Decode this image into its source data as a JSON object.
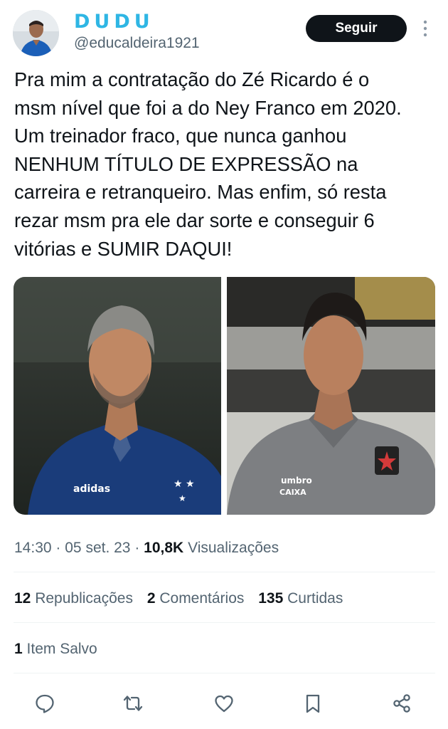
{
  "author": {
    "display_name": "DUDU",
    "handle": "@educaldeira1921"
  },
  "follow_label": "Seguir",
  "tweet": {
    "text": "Pra mim a contratação do Zé Ricardo é o\nmsm nível que foi a do Ney Franco em 2020.\nUm treinador fraco, que nunca ganhou\nNENHUM TÍTULO DE EXPRESSÃO na\ncarreira e retranqueiro. Mas enfim, só resta\nrezar msm pra ele dar sorte e conseguir 6\nvitórias e SUMIR DAQUI!"
  },
  "meta": {
    "time": "14:30",
    "separator": "·",
    "date": "05 set. 23",
    "views_count": "10,8K",
    "views_label": "Visualizações"
  },
  "stats": {
    "reposts_count": "12",
    "reposts_label": "Republicações",
    "comments_count": "2",
    "comments_label": "Comentários",
    "likes_count": "135",
    "likes_label": "Curtidas"
  },
  "saved": {
    "count": "1",
    "label": "Item Salvo"
  },
  "actions": [
    "reply-icon",
    "repost-icon",
    "like-icon",
    "bookmark-icon",
    "share-icon"
  ],
  "colors": {
    "name_accent": "#2fb6e4",
    "text": "#0f1419",
    "secondary": "#536471",
    "divider": "#eff3f4",
    "button_bg": "#0f1419"
  }
}
